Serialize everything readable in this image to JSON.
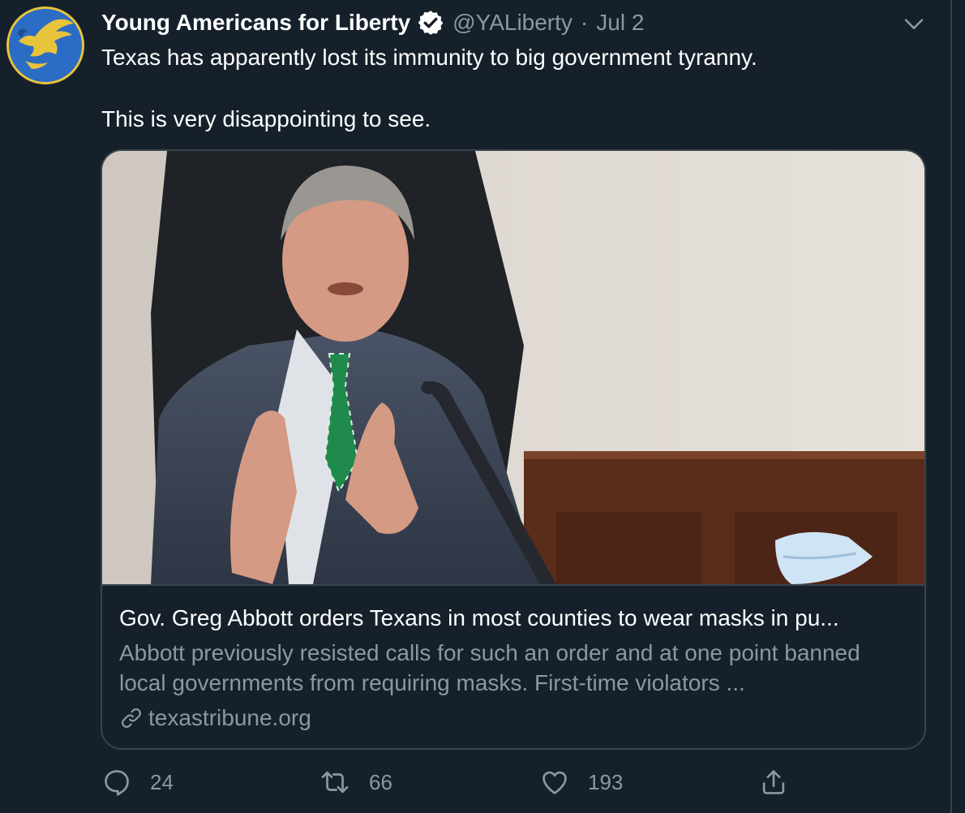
{
  "tweet": {
    "display_name": "Young Americans for Liberty",
    "verified": true,
    "handle": "@YALiberty",
    "separator": "·",
    "date": "Jul 2",
    "text_lines": [
      "Texas has apparently lost its immunity to big government tyranny.",
      "This is very disappointing to see."
    ]
  },
  "card": {
    "title": "Gov. Greg Abbott orders Texans in most counties to wear masks in pu...",
    "description": "Abbott previously resisted calls for such an order and at one point banned local governments from requiring masks. First-time violators ...",
    "domain": "texastribune.org"
  },
  "actions": {
    "replies": "24",
    "retweets": "66",
    "likes": "193"
  },
  "icons": {
    "verified": "verified-badge-icon",
    "chevron": "chevron-down-icon",
    "link": "link-icon",
    "reply": "reply-icon",
    "retweet": "retweet-icon",
    "like": "heart-icon",
    "share": "share-icon"
  },
  "colors": {
    "background": "#15202b",
    "border": "#38444d",
    "secondary_text": "#8899a6",
    "primary_text": "#ffffff",
    "avatar_blue": "#2b6cc4",
    "avatar_gold": "#e8c33c"
  }
}
